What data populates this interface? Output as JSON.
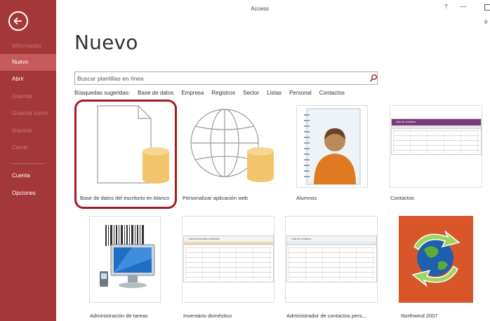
{
  "titlebar": {
    "title": "Access",
    "help_label": "?",
    "minimize_label": "—",
    "user_text": "Ir"
  },
  "sidebar": {
    "items": [
      {
        "label": "Información",
        "enabled": false
      },
      {
        "label": "Nuevo",
        "enabled": true,
        "active": true
      },
      {
        "label": "Abrir",
        "enabled": true
      },
      {
        "label": "Guardar",
        "enabled": false
      },
      {
        "label": "Guardar como",
        "enabled": false
      },
      {
        "label": "Imprimir",
        "enabled": false
      },
      {
        "label": "Cerrar",
        "enabled": false
      },
      {
        "label": "Cuenta",
        "enabled": true
      },
      {
        "label": "Opciones",
        "enabled": true
      }
    ]
  },
  "main": {
    "title": "Nuevo",
    "search": {
      "placeholder": "Buscar plantillas en línea",
      "value": ""
    },
    "suggested": {
      "label": "Búsquedas sugeridas:",
      "items": [
        "Base de datos",
        "Empresa",
        "Registros",
        "Sector",
        "Listas",
        "Personal",
        "Contactos"
      ]
    },
    "templates": [
      {
        "label": "Base de datos del escritorio en blanco",
        "icon": "blank-database-icon",
        "selected": true
      },
      {
        "label": "Personalizar aplicación web",
        "icon": "web-app-globe-icon"
      },
      {
        "label": "Alumnos",
        "icon": "student-contact-card-icon"
      },
      {
        "label": "Contactos",
        "icon": "contacts-thumbnail",
        "thumb_title": "Lista de contactos"
      },
      {
        "label": "Administración de tareas",
        "icon": "computer-barcode-icon"
      },
      {
        "label": "Inventario doméstico",
        "icon": "inventory-thumbnail",
        "thumb_title": "Lista de inventario doméstico"
      },
      {
        "label": "Administrador de contactos pers...",
        "icon": "contacts-manager-thumbnail",
        "thumb_title": "Lista de contactos"
      },
      {
        "label": "Northwind 2007",
        "icon": "northwind-globe-icon"
      }
    ]
  },
  "colors": {
    "sidebar_bg": "#a4373a",
    "sidebar_active": "#c55a5d",
    "highlight": "#a01d22",
    "database_gold": "#f2c46c"
  }
}
